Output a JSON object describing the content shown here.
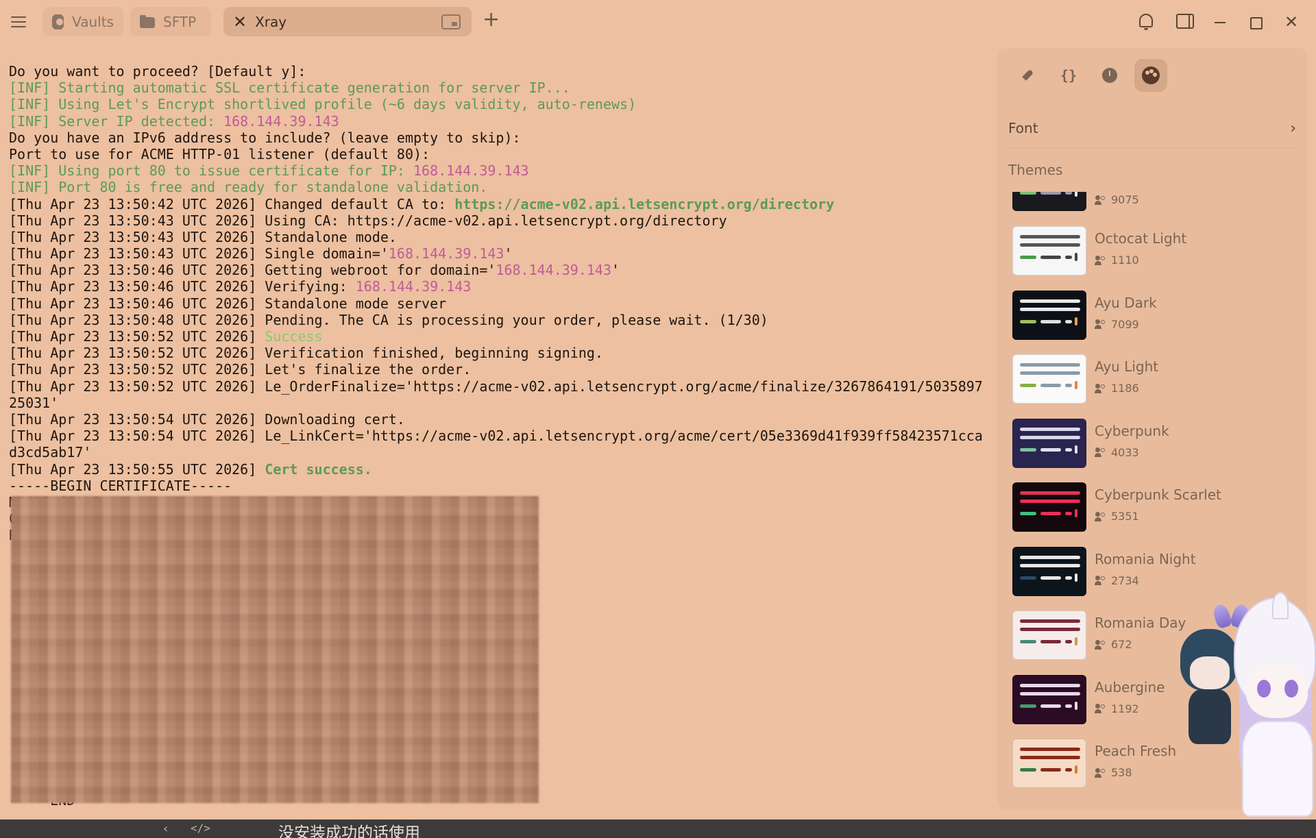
{
  "tabs": [
    {
      "label": "Vaults",
      "active": false,
      "icon": "vault-icon"
    },
    {
      "label": "SFTP",
      "active": false,
      "icon": "folder-icon"
    },
    {
      "label": "Xray",
      "active": true,
      "icon": "close-icon"
    }
  ],
  "window": {
    "add_tab": "+",
    "close": "✕"
  },
  "terminal": {
    "lines": [
      [
        {
          "t": "Do you want to proceed? [Default y]:",
          "c": ""
        }
      ],
      [
        {
          "t": "[INF] Starting automatic SSL certificate generation for server IP...",
          "c": "green"
        }
      ],
      [
        {
          "t": "[INF] Using Let's Encrypt shortlived profile (~6 days validity, auto-renews)",
          "c": "green"
        }
      ],
      [
        {
          "t": "[INF] Server IP detected: ",
          "c": "green"
        },
        {
          "t": "168.144.39.143",
          "c": "pink"
        }
      ],
      [
        {
          "t": "Do you have an IPv6 address to include? (leave empty to skip):",
          "c": ""
        }
      ],
      [
        {
          "t": "Port to use for ACME HTTP-01 listener (default 80):",
          "c": ""
        }
      ],
      [
        {
          "t": "[INF] Using port 80 to issue certificate for IP: ",
          "c": "green"
        },
        {
          "t": "168.144.39.143",
          "c": "pink"
        }
      ],
      [
        {
          "t": "[INF] Port 80 is free and ready for standalone validation.",
          "c": "green"
        }
      ],
      [
        {
          "t": "[Thu Apr 23 13:50:42 UTC 2026] Changed default CA to: ",
          "c": ""
        },
        {
          "t": "https://acme-v02.api.letsencrypt.org/directory",
          "c": "bgreen"
        }
      ],
      [
        {
          "t": "[Thu Apr 23 13:50:43 UTC 2026] Using CA: https://acme-v02.api.letsencrypt.org/directory",
          "c": ""
        }
      ],
      [
        {
          "t": "[Thu Apr 23 13:50:43 UTC 2026] Standalone mode.",
          "c": ""
        }
      ],
      [
        {
          "t": "[Thu Apr 23 13:50:43 UTC 2026] Single domain='",
          "c": ""
        },
        {
          "t": "168.144.39.143",
          "c": "pink"
        },
        {
          "t": "'",
          "c": ""
        }
      ],
      [
        {
          "t": "[Thu Apr 23 13:50:46 UTC 2026] Getting webroot for domain='",
          "c": ""
        },
        {
          "t": "168.144.39.143",
          "c": "pink"
        },
        {
          "t": "'",
          "c": ""
        }
      ],
      [
        {
          "t": "[Thu Apr 23 13:50:46 UTC 2026] Verifying: ",
          "c": ""
        },
        {
          "t": "168.144.39.143",
          "c": "pink"
        }
      ],
      [
        {
          "t": "[Thu Apr 23 13:50:46 UTC 2026] Standalone mode server",
          "c": ""
        }
      ],
      [
        {
          "t": "[Thu Apr 23 13:50:48 UTC 2026] Pending. The CA is processing your order, please wait. (1/30)",
          "c": ""
        }
      ],
      [
        {
          "t": "[Thu Apr 23 13:50:52 UTC 2026] ",
          "c": ""
        },
        {
          "t": "Success",
          "c": "lgreen"
        }
      ],
      [
        {
          "t": "[Thu Apr 23 13:50:52 UTC 2026] Verification finished, beginning signing.",
          "c": ""
        }
      ],
      [
        {
          "t": "[Thu Apr 23 13:50:52 UTC 2026] Let's finalize the order.",
          "c": ""
        }
      ],
      [
        {
          "t": "[Thu Apr 23 13:50:52 UTC 2026] Le_OrderFinalize='https://acme-v02.api.letsencrypt.org/acme/finalize/3267864191/5035897",
          "c": ""
        }
      ],
      [
        {
          "t": "25031'",
          "c": ""
        }
      ],
      [
        {
          "t": "[Thu Apr 23 13:50:54 UTC 2026] Downloading cert.",
          "c": ""
        }
      ],
      [
        {
          "t": "[Thu Apr 23 13:50:54 UTC 2026] Le_LinkCert='https://acme-v02.api.letsencrypt.org/acme/cert/05e3369d41f939ff58423571cca",
          "c": ""
        }
      ],
      [
        {
          "t": "d3cd5ab17'",
          "c": ""
        }
      ],
      [
        {
          "t": "[Thu Apr 23 13:50:55 UTC 2026] ",
          "c": ""
        },
        {
          "t": "Cert success.",
          "c": "bgreen"
        }
      ],
      [
        {
          "t": "-----BEGIN CERTIFICATE-----",
          "c": ""
        }
      ],
      [
        {
          "t": "MIIDSzCCAtCg",
          "c": ""
        }
      ],
      [
        {
          "t": "CzAJBgN",
          "c": ""
        }
      ],
      [
        {
          "t": "RT",
          "c": ""
        }
      ],
      [
        {
          "t": "",
          "c": ""
        }
      ],
      [
        {
          "t": "",
          "c": ""
        }
      ],
      [
        {
          "t": "",
          "c": ""
        }
      ],
      [
        {
          "t": "",
          "c": ""
        }
      ],
      [
        {
          "t": "",
          "c": ""
        }
      ],
      [
        {
          "t": "",
          "c": ""
        }
      ],
      [
        {
          "t": "",
          "c": ""
        }
      ],
      [
        {
          "t": "",
          "c": ""
        }
      ],
      [
        {
          "t": "",
          "c": ""
        }
      ],
      [
        {
          "t": "",
          "c": ""
        }
      ],
      [
        {
          "t": "",
          "c": ""
        }
      ],
      [
        {
          "t": "",
          "c": ""
        }
      ],
      [
        {
          "t": "",
          "c": ""
        }
      ],
      [
        {
          "t": "",
          "c": ""
        }
      ],
      [
        {
          "t": "",
          "c": ""
        }
      ],
      [
        {
          "t": "-----END",
          "c": ""
        }
      ]
    ]
  },
  "bottom_bar": {
    "back": "‹",
    "code": "</>",
    "caption": "没安装成功的话使用"
  },
  "panel": {
    "font_label": "Font",
    "font_chevron": "›",
    "braces": "{}",
    "themes_title": "Themes",
    "themes": [
      {
        "name": "",
        "users": "9075",
        "bg": "#1a1a1e",
        "bars": [
          "#7ac070",
          "#9a9aa8",
          "#e8e8f0"
        ],
        "top": "#cccccc",
        "partial": true
      },
      {
        "name": "Octocat Light",
        "users": "1110",
        "bg": "#f6f6f6",
        "bars": [
          "#4a9a4a",
          "#444444",
          "#444444"
        ],
        "top": "#555555",
        "partial": false
      },
      {
        "name": "Ayu Dark",
        "users": "7099",
        "bg": "#0d1117",
        "bars": [
          "#a0c060",
          "#e0e0e0",
          "#f0a040"
        ],
        "top": "#e8e8e8",
        "partial": false
      },
      {
        "name": "Ayu Light",
        "users": "1186",
        "bg": "#fafafa",
        "bars": [
          "#88b040",
          "#8a9aa8",
          "#f08040"
        ],
        "top": "#8a9aa8",
        "partial": false
      },
      {
        "name": "Cyberpunk",
        "users": "4033",
        "bg": "#2a2450",
        "bars": [
          "#7ac0a0",
          "#e0e0f0",
          "#e0e0f0"
        ],
        "top": "#d8d8ec",
        "partial": false
      },
      {
        "name": "Cyberpunk Scarlet",
        "users": "5351",
        "bg": "#14080c",
        "bars": [
          "#40c080",
          "#e8305a",
          "#e8305a"
        ],
        "top": "#e8305a",
        "partial": false
      },
      {
        "name": "Romania Night",
        "users": "2734",
        "bg": "#0c141c",
        "bars": [
          "#2a4a6a",
          "#e8e8e8",
          "#e8e8e8"
        ],
        "top": "#e8e8e8",
        "partial": false
      },
      {
        "name": "Romania Day",
        "users": "672",
        "bg": "#f6ecec",
        "bars": [
          "#4a8a7a",
          "#7a2a3a",
          "#c8a040"
        ],
        "top": "#7a2a3a",
        "partial": false
      },
      {
        "name": "Aubergine",
        "users": "1192",
        "bg": "#2c0c24",
        "bars": [
          "#40a070",
          "#e8d8e8",
          "#e8d8e8"
        ],
        "top": "#e8d8e8",
        "partial": false
      },
      {
        "name": "Peach Fresh",
        "users": "538",
        "bg": "#f6dcc6",
        "bars": [
          "#3a7a4a",
          "#8a2a1a",
          "#d88030"
        ],
        "top": "#8a2a1a",
        "partial": false
      }
    ]
  },
  "colors": {
    "background": "#ecc0a0",
    "panel": "#e8bb9c",
    "green": "#5c9a58",
    "pink": "#c05a9a"
  }
}
